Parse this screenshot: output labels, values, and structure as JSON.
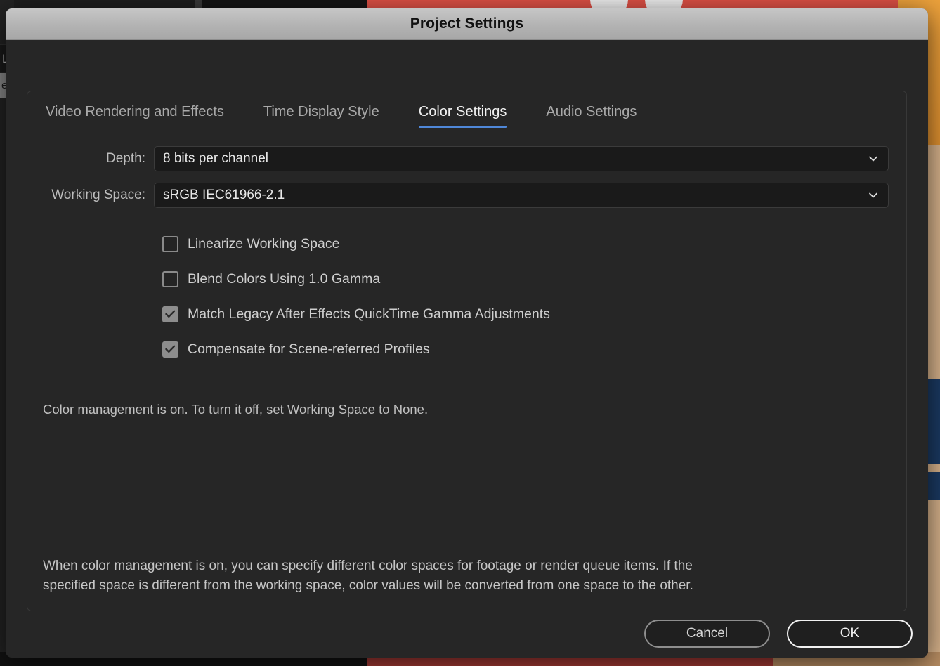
{
  "window": {
    "title": "Project Settings"
  },
  "tabs": [
    {
      "label": "Video Rendering and Effects",
      "active": false
    },
    {
      "label": "Time Display Style",
      "active": false
    },
    {
      "label": "Color Settings",
      "active": true
    },
    {
      "label": "Audio Settings",
      "active": false
    }
  ],
  "form": {
    "depth": {
      "label": "Depth:",
      "value": "8 bits per channel",
      "icon": "chevron-down-icon"
    },
    "working_space": {
      "label": "Working Space:",
      "value": "sRGB IEC61966-2.1",
      "icon": "chevron-down-icon"
    }
  },
  "checkboxes": [
    {
      "label": "Linearize Working Space",
      "checked": false
    },
    {
      "label": "Blend Colors Using 1.0 Gamma",
      "checked": false
    },
    {
      "label": "Match Legacy After Effects QuickTime Gamma Adjustments",
      "checked": true
    },
    {
      "label": "Compensate for Scene-referred Profiles",
      "checked": true
    }
  ],
  "messages": {
    "status_note": "Color management is on. To turn it off, set Working Space to None.",
    "description": "When color management is on, you can specify different color spaces for footage or render queue items. If the specified space is different from the working space, color values will be converted from one space to the other."
  },
  "footer": {
    "cancel_label": "Cancel",
    "ok_label": "OK"
  },
  "background": {
    "left_row_a": "L",
    "left_row_b": "e"
  },
  "colors": {
    "accent_tab_underline": "#4f87d8",
    "titlebar_top": "#c6c6c6",
    "titlebar_bottom": "#a7a7a7",
    "dialog_bg": "#262626",
    "field_bg": "#1a1a1a",
    "checkbox_checked": "#8d8d8d",
    "art_red": "#e05146",
    "art_orange": "#eda23c",
    "art_tan": "#d9b48c",
    "art_navy": "#1b3a63"
  }
}
